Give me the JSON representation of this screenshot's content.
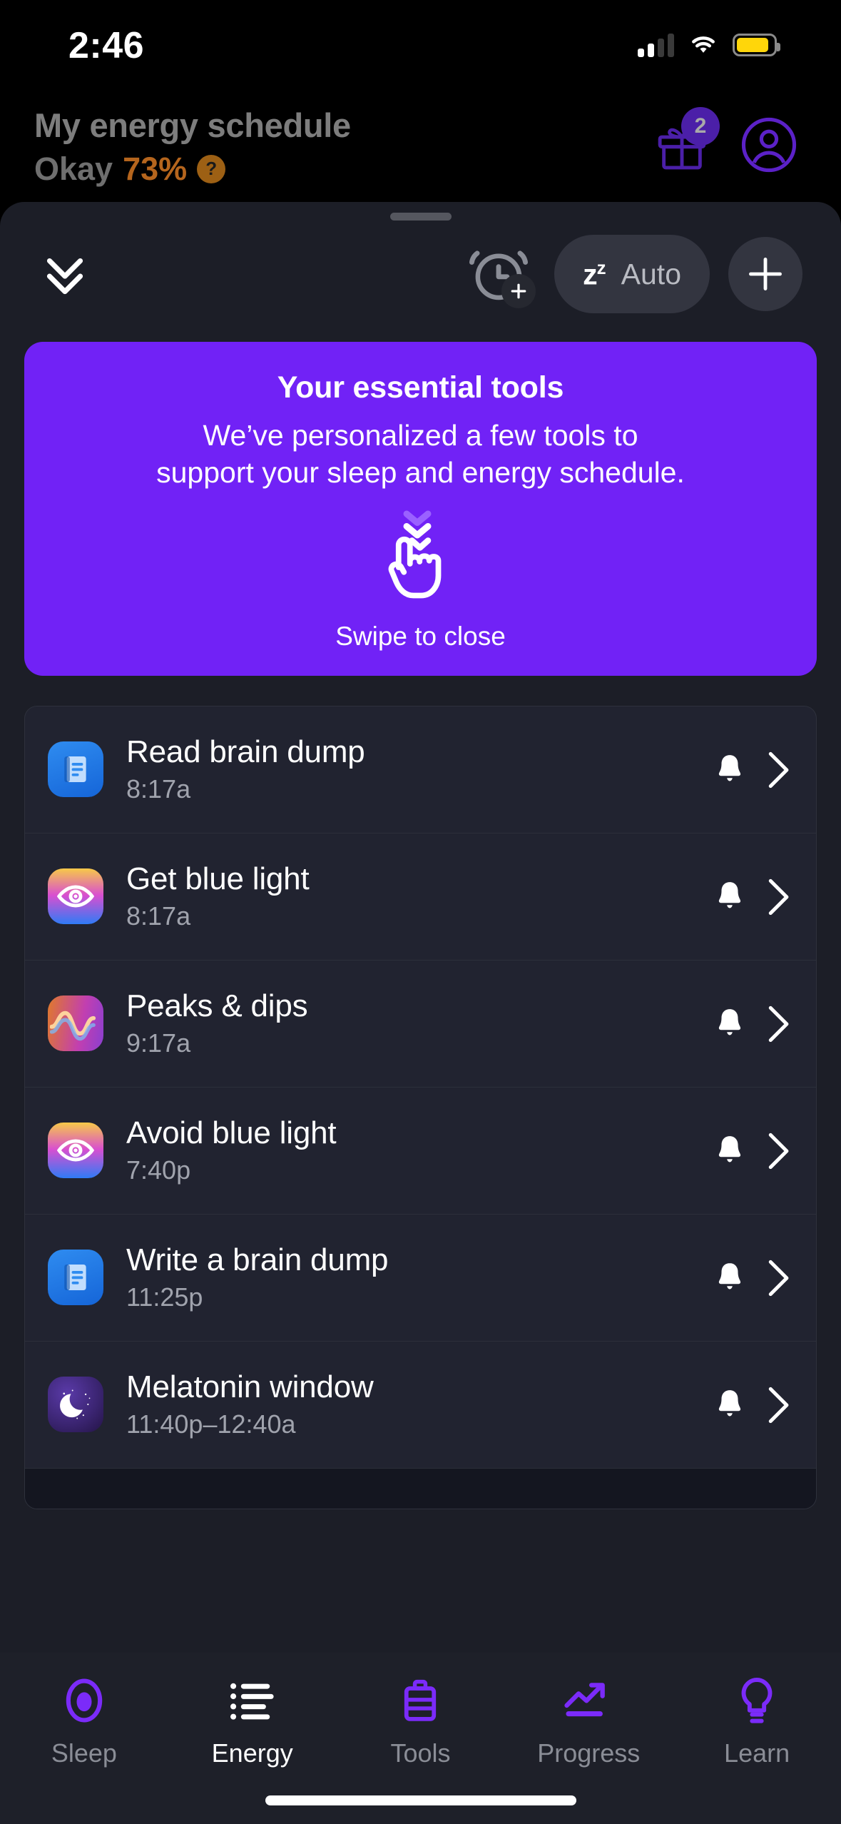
{
  "status_bar": {
    "time": "2:46",
    "signal_icon": "cellular-signal-icon",
    "wifi_icon": "wifi-icon",
    "battery_icon": "battery-low-power-icon",
    "battery_color": "#FFD60A"
  },
  "background_header": {
    "title": "My energy schedule",
    "status_label": "Okay",
    "status_percent": "73%",
    "help_glyph": "?",
    "percent_color": "#b5651d",
    "gift_icon": "gift-icon",
    "gift_badge_count": "2",
    "profile_icon": "profile-avatar-icon"
  },
  "sheet_toolbar": {
    "collapse_icon": "double-chevron-down-icon",
    "add_alarm_icon": "alarm-clock-plus-icon",
    "auto_pill": {
      "zz_label": "z",
      "zz_sup": "z",
      "label": "Auto"
    },
    "add_icon": "plus-icon"
  },
  "promo_card": {
    "title": "Your essential tools",
    "body_line1": "We’ve personalized a few tools to",
    "body_line2": "support your sleep and energy schedule.",
    "swipe_icon": "swipe-down-hand-icon",
    "swipe_label": "Swipe to close",
    "background_color": "#7122f6"
  },
  "schedule_list": [
    {
      "icon": "document-note-icon",
      "icon_style": "ic-note",
      "title": "Read brain dump",
      "time": "8:17a",
      "bell_icon": "bell-icon",
      "chevron_icon": "chevron-right-icon"
    },
    {
      "icon": "eye-icon",
      "icon_style": "ic-eye",
      "title": "Get blue light",
      "time": "8:17a",
      "bell_icon": "bell-icon",
      "chevron_icon": "chevron-right-icon"
    },
    {
      "icon": "energy-wave-icon",
      "icon_style": "ic-wave",
      "title": "Peaks & dips",
      "time": "9:17a",
      "bell_icon": "bell-icon",
      "chevron_icon": "chevron-right-icon"
    },
    {
      "icon": "eye-icon",
      "icon_style": "ic-eye",
      "title": "Avoid blue light",
      "time": "7:40p",
      "bell_icon": "bell-icon",
      "chevron_icon": "chevron-right-icon"
    },
    {
      "icon": "document-note-icon",
      "icon_style": "ic-note",
      "title": "Write a brain dump",
      "time": "11:25p",
      "bell_icon": "bell-icon",
      "chevron_icon": "chevron-right-icon"
    },
    {
      "icon": "crescent-moon-icon",
      "icon_style": "ic-moon",
      "title": "Melatonin window",
      "time": "11:40p–12:40a",
      "bell_icon": "bell-icon",
      "chevron_icon": "chevron-right-icon"
    }
  ],
  "tab_bar": {
    "accent_color": "#7B2BF9",
    "active_tab": "Energy",
    "tabs": [
      {
        "label": "Sleep",
        "icon": "sleep-ring-icon",
        "active": false
      },
      {
        "label": "Energy",
        "icon": "list-lines-icon",
        "active": true
      },
      {
        "label": "Tools",
        "icon": "toolbox-icon",
        "active": false
      },
      {
        "label": "Progress",
        "icon": "trending-up-icon",
        "active": false
      },
      {
        "label": "Learn",
        "icon": "lightbulb-icon",
        "active": false
      }
    ]
  },
  "home_indicator": "home-indicator"
}
